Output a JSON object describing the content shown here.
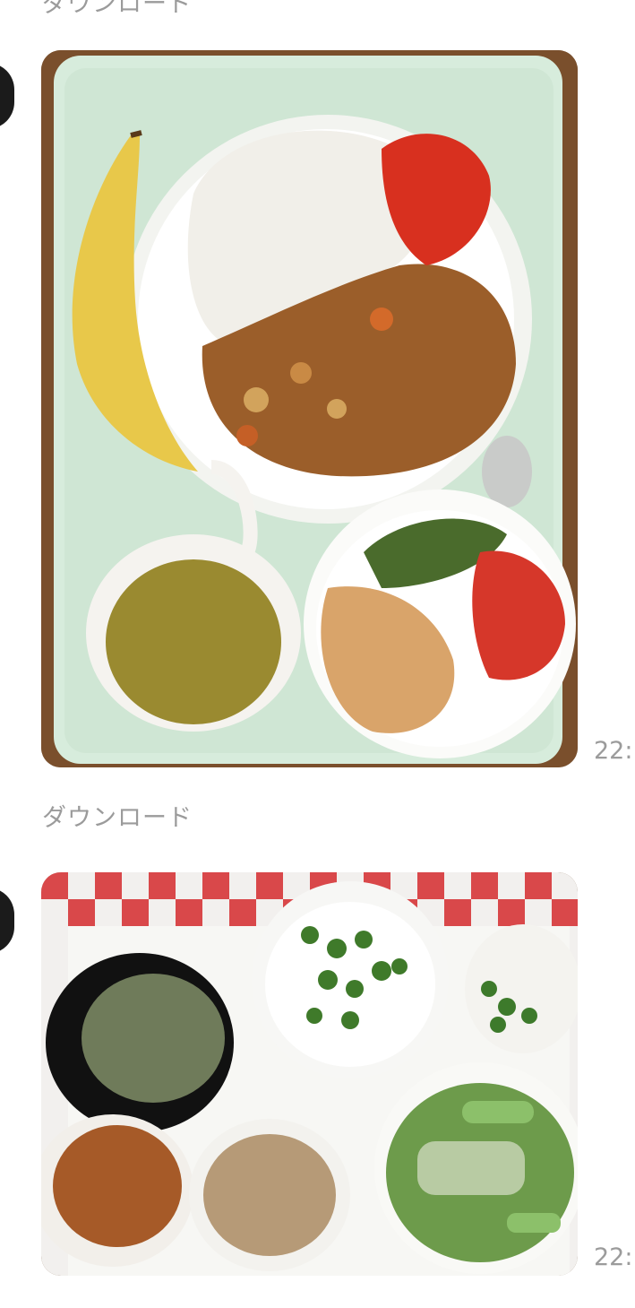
{
  "messages": [
    {
      "download_label": "ダウンロード",
      "time": "22:",
      "photo_alt": "curry-rice-meal-photo"
    },
    {
      "download_label": "ダウンロード",
      "time": "22:",
      "photo_alt": "okra-meal-photo"
    }
  ],
  "colors": {
    "meta_text": "#9b9b9b",
    "avatar": "#1b1b1b"
  }
}
